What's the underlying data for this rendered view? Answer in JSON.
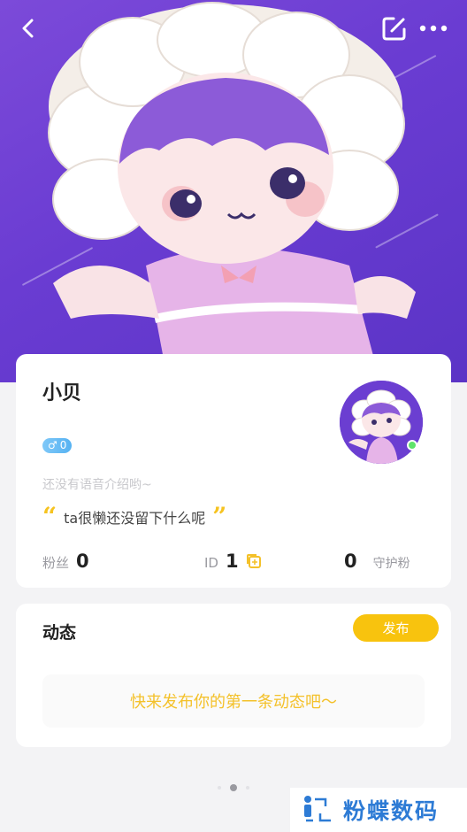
{
  "header": {
    "back_icon": "chevron-left-icon",
    "edit_icon": "edit-icon",
    "more_icon": "more-dots-icon"
  },
  "profile": {
    "name": "小贝",
    "gender_symbol": "♂",
    "level": "0",
    "voice_intro": "还没有语音介绍哟~",
    "signature": "ta很懒还没留下什么呢",
    "fans_label": "粉丝",
    "fans_count": "0",
    "id_label": "ID",
    "id_value": "1",
    "guard_count": "0",
    "guard_label": "守护粉"
  },
  "feed": {
    "title": "动态",
    "publish_label": "发布",
    "empty_text": "快来发布你的第一条动态吧～"
  },
  "watermark": {
    "text": "粉蝶数码"
  },
  "colors": {
    "hero_purple": "#6a3cd2",
    "accent_yellow": "#f8c30e",
    "online_green": "#5fe36a",
    "gender_blue": "#56b2f2"
  }
}
